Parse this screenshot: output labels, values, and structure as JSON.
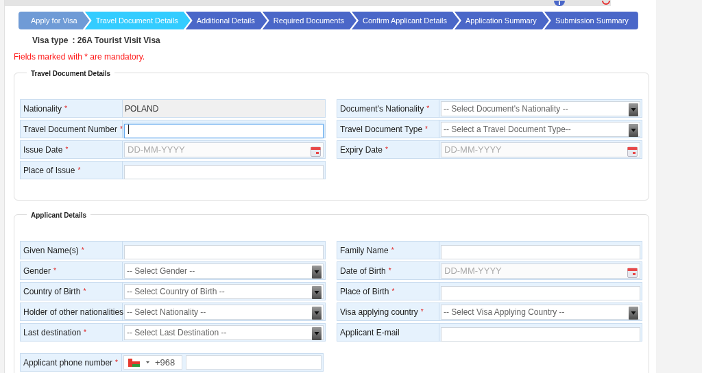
{
  "steps": [
    {
      "label": "Apply for Visa",
      "selected": false,
      "completed": true
    },
    {
      "label": "Travel Document Details",
      "selected": true,
      "completed": false
    },
    {
      "label": "Additional Details",
      "selected": false,
      "completed": false
    },
    {
      "label": "Required Documents",
      "selected": false,
      "completed": false
    },
    {
      "label": "Confirm Applicant Details",
      "selected": false,
      "completed": false
    },
    {
      "label": "Application Summary",
      "selected": false,
      "completed": false
    },
    {
      "label": "Submission Summary",
      "selected": false,
      "completed": false
    }
  ],
  "visa_type": {
    "label": "Visa type",
    "value": ": 26A Tourist Visit Visa"
  },
  "mandatory_note": "Fields marked with * are mandatory.",
  "sections": [
    {
      "title": "Travel Document Details",
      "rows": [
        [
          {
            "label": "Nationality",
            "required_mark": "*",
            "kind": "static",
            "value": "POLAND"
          },
          {
            "label": "Document's Nationality",
            "required_mark": "*",
            "kind": "select",
            "placeholder": "-- Select Document's Nationality --"
          }
        ],
        [
          {
            "label": "Travel Document Number",
            "required_mark": "*",
            "kind": "text",
            "focused": true
          },
          {
            "label": "Travel Document Type",
            "required_mark": "*",
            "kind": "select",
            "placeholder": "-- Select a Travel Document Type--"
          }
        ],
        [
          {
            "label": "Issue Date",
            "required_mark": "*",
            "kind": "date",
            "placeholder": "DD-MM-YYYY"
          },
          {
            "label": "Expiry Date",
            "required_mark": "*",
            "kind": "date",
            "placeholder": "DD-MM-YYYY"
          }
        ],
        [
          {
            "label": "Place of Issue",
            "required_mark": "*",
            "kind": "text",
            "focused": false
          }
        ]
      ]
    },
    {
      "title": "Applicant Details",
      "rows": [
        [
          {
            "label": "Given Name(s)",
            "required_mark": "*",
            "kind": "text",
            "focused": false
          },
          {
            "label": "Family Name",
            "required_mark": "*",
            "kind": "text",
            "focused": false
          }
        ],
        [
          {
            "label": "Gender",
            "required_mark": "*",
            "kind": "select",
            "placeholder": "-- Select Gender --"
          },
          {
            "label": "Date of Birth",
            "required_mark": "*",
            "kind": "date",
            "placeholder": "DD-MM-YYYY"
          }
        ],
        [
          {
            "label": "Country of Birth",
            "required_mark": "*",
            "kind": "select",
            "placeholder": "-- Select Country of Birth --"
          },
          {
            "label": "Place of Birth",
            "required_mark": "*",
            "kind": "text",
            "focused": false
          }
        ],
        [
          {
            "label": "Holder of other nationalities",
            "kind": "select",
            "placeholder": "-- Select Nationality --"
          },
          {
            "label": "Visa applying country",
            "required_mark": "*",
            "kind": "select",
            "placeholder": "-- Select Visa Applying Country --"
          }
        ],
        [
          {
            "label": "Last destination",
            "required_mark": "*",
            "kind": "select",
            "placeholder": "-- Select Last Destination --"
          },
          {
            "label": "Applicant E-mail",
            "kind": "text",
            "focused": false
          }
        ]
      ],
      "phone": {
        "label": "Applicant phone number",
        "required_mark": "*",
        "code": "+968"
      }
    }
  ]
}
